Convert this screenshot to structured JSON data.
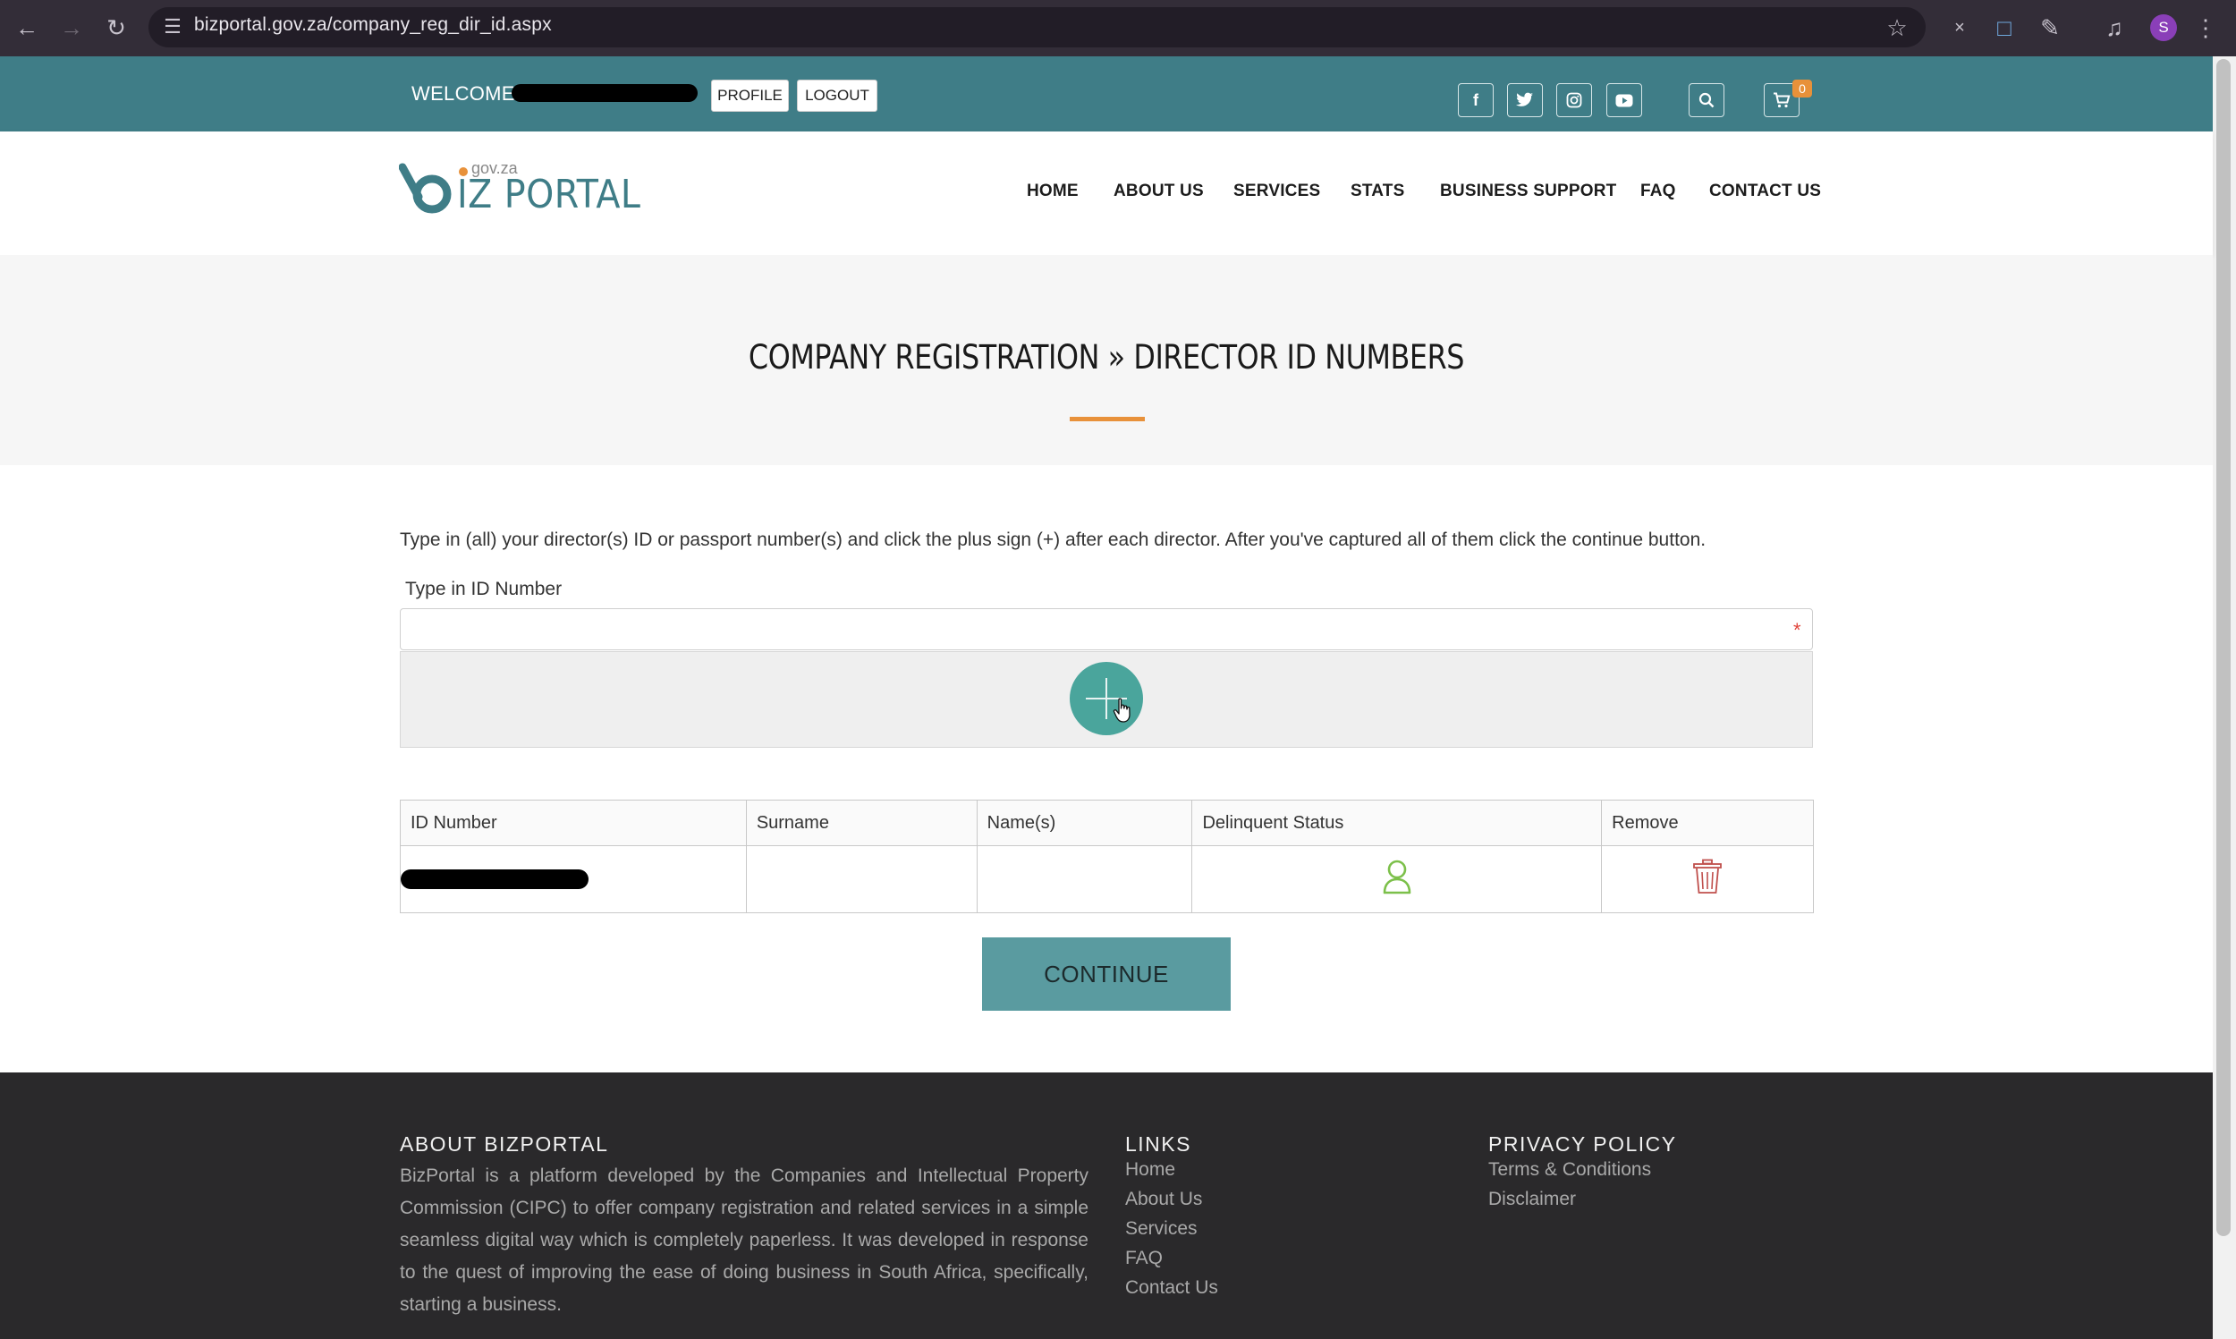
{
  "browser": {
    "url": "bizportal.gov.za/company_reg_dir_id.aspx",
    "profile_initial": "S"
  },
  "topbar": {
    "welcome": "WELCOME",
    "profile_label": "PROFILE",
    "logout_label": "LOGOUT",
    "cart_count": "0",
    "social_icons": [
      "facebook-icon",
      "twitter-icon",
      "instagram-icon",
      "youtube-icon"
    ]
  },
  "logo": {
    "main": "IZ PORTAL",
    "sub": "gov.za"
  },
  "nav": {
    "home": "HOME",
    "about": "ABOUT US",
    "services": "SERVICES",
    "stats": "STATS",
    "business_support": "BUSINESS SUPPORT",
    "faq": "FAQ",
    "contact": "CONTACT US"
  },
  "page": {
    "title": "COMPANY REGISTRATION » DIRECTOR ID NUMBERS",
    "instructions": "Type in (all) your director(s) ID or passport number(s) and click the plus sign (+) after each director. After you've captured all of them click the continue button.",
    "field_label": "Type in ID Number",
    "field_value": "",
    "required_mark": "*",
    "continue_label": "CONTINUE"
  },
  "table": {
    "headers": [
      "ID Number",
      "Surname",
      "Name(s)",
      "Delinquent Status",
      "Remove"
    ],
    "rows": [
      {
        "surname": "",
        "names": ""
      }
    ]
  },
  "footer": {
    "about_heading": "ABOUT BIZPORTAL",
    "about_text": "BizPortal is a platform developed by the Companies and Intellectual Property Commission (CIPC) to offer company registration and related services in a simple seamless digital way which is completely paperless. It was developed in response to the quest of improving the ease of doing business in South Africa, specifically, starting a business.",
    "links_heading": "LINKS",
    "links": [
      "Home",
      "About Us",
      "Services",
      "FAQ",
      "Contact Us"
    ],
    "privacy_heading": "PRIVACY POLICY",
    "privacy_links": [
      "Terms & Conditions",
      "Disclaimer"
    ]
  },
  "colors": {
    "topbar": "#3f7d87",
    "accent": "#e8913a",
    "add_button": "#4aa59c",
    "continue_button": "#5a9ba0",
    "footer": "#2a292b"
  }
}
